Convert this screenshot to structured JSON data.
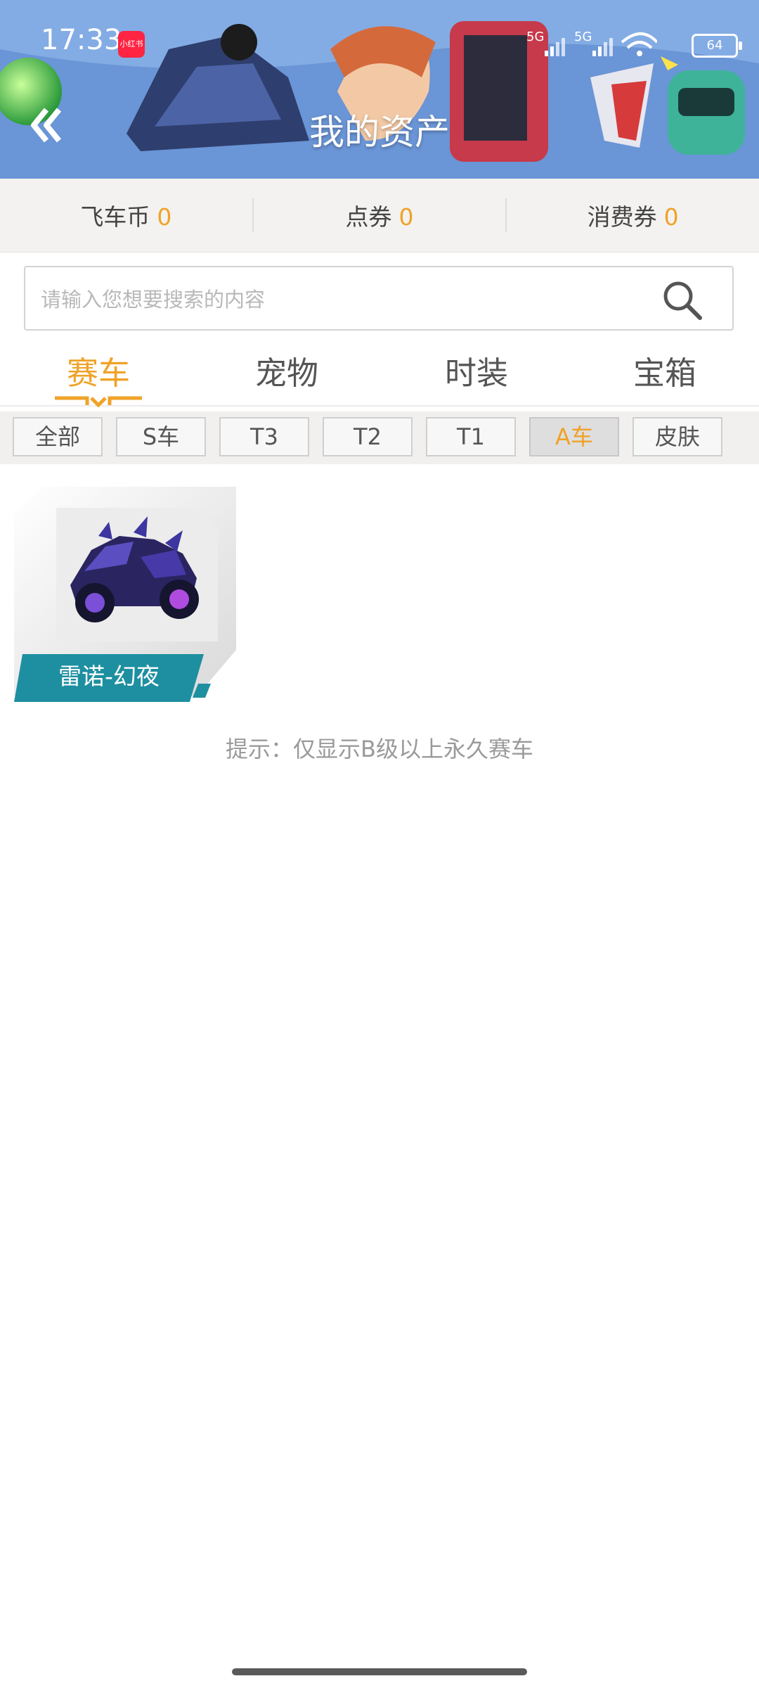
{
  "status_bar": {
    "time": "17:33",
    "app_icon_text": "小红书",
    "network_1": "5G",
    "network_2": "5G",
    "battery": "64"
  },
  "header": {
    "title": "我的资产"
  },
  "currency": [
    {
      "label": "飞车币",
      "value": "0"
    },
    {
      "label": "点券",
      "value": "0"
    },
    {
      "label": "消费券",
      "value": "0"
    }
  ],
  "search": {
    "placeholder": "请输入您想要搜索的内容"
  },
  "tabs": [
    {
      "label": "赛车",
      "active": true
    },
    {
      "label": "宠物",
      "active": false
    },
    {
      "label": "时装",
      "active": false
    },
    {
      "label": "宝箱",
      "active": false
    }
  ],
  "filters": [
    {
      "label": "全部",
      "active": false
    },
    {
      "label": "S车",
      "active": false
    },
    {
      "label": "T3",
      "active": false
    },
    {
      "label": "T2",
      "active": false
    },
    {
      "label": "T1",
      "active": false
    },
    {
      "label": "A车",
      "active": true
    },
    {
      "label": "皮肤",
      "active": false
    }
  ],
  "items": [
    {
      "name": "雷诺-幻夜"
    }
  ],
  "hint": "提示：仅显示B级以上永久赛车",
  "colors": {
    "accent": "#f0a228",
    "label_bg": "#1e8fa0",
    "banner": "#5b86c9"
  }
}
